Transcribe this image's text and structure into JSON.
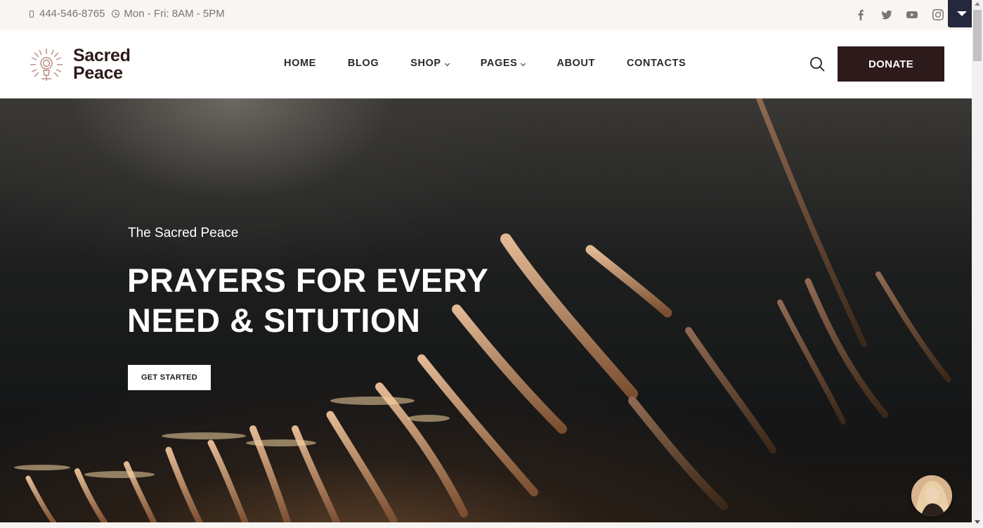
{
  "topbar": {
    "phone": "444-546-8765",
    "hours": "Mon - Fri: 8AM - 5PM",
    "social_icons": [
      "facebook-icon",
      "twitter-icon",
      "youtube-icon",
      "instagram-icon"
    ],
    "background": "#f8f5f2"
  },
  "header": {
    "logo_line1": "Sacred",
    "logo_line2": "Peace",
    "nav": [
      {
        "label": "HOME",
        "has_dropdown": false
      },
      {
        "label": "BLOG",
        "has_dropdown": false
      },
      {
        "label": "SHOP",
        "has_dropdown": true
      },
      {
        "label": "PAGES",
        "has_dropdown": true
      },
      {
        "label": "ABOUT",
        "has_dropdown": false
      },
      {
        "label": "CONTACTS",
        "has_dropdown": false
      }
    ],
    "donate_label": "DONATE",
    "donate_color": "#2d1a1b"
  },
  "hero": {
    "eyebrow": "The Sacred Peace",
    "title_line1": "PRAYERS FOR EVERY",
    "title_line2": "NEED & SITUTION",
    "cta_label": "GET STARTED"
  },
  "colors": {
    "accent": "#2d1a1b",
    "logo_mark": "#b98a7e",
    "toggle_tab": "#24283d"
  }
}
